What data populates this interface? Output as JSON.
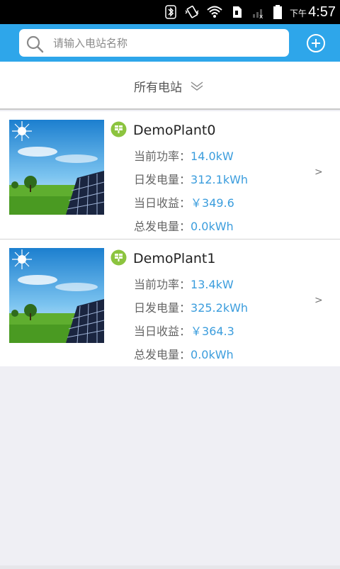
{
  "status_bar": {
    "am_pm": "下午",
    "time": "4:57"
  },
  "header": {
    "search_placeholder": "请输入电站名称",
    "icons": [
      "search-icon",
      "add-icon"
    ],
    "accent_color": "#2ea6ea"
  },
  "filter": {
    "label": "所有电站"
  },
  "plants": [
    {
      "name": "DemoPlant0",
      "power_label": "当前功率：",
      "power_value": "14.0kW",
      "daily_gen_label": "日发电量：",
      "daily_gen_value": "312.1kWh",
      "daily_income_label": "当日收益：",
      "daily_income_value": "￥349.6",
      "total_gen_label": "总发电量：",
      "total_gen_value": "0.0kWh",
      "chevron": ">"
    },
    {
      "name": "DemoPlant1",
      "power_label": "当前功率：",
      "power_value": "13.4kW",
      "daily_gen_label": "日发电量：",
      "daily_gen_value": "325.2kWh",
      "daily_income_label": "当日收益：",
      "daily_income_value": "￥364.3",
      "total_gen_label": "总发电量：",
      "total_gen_value": "0.0kWh",
      "chevron": ">"
    }
  ]
}
